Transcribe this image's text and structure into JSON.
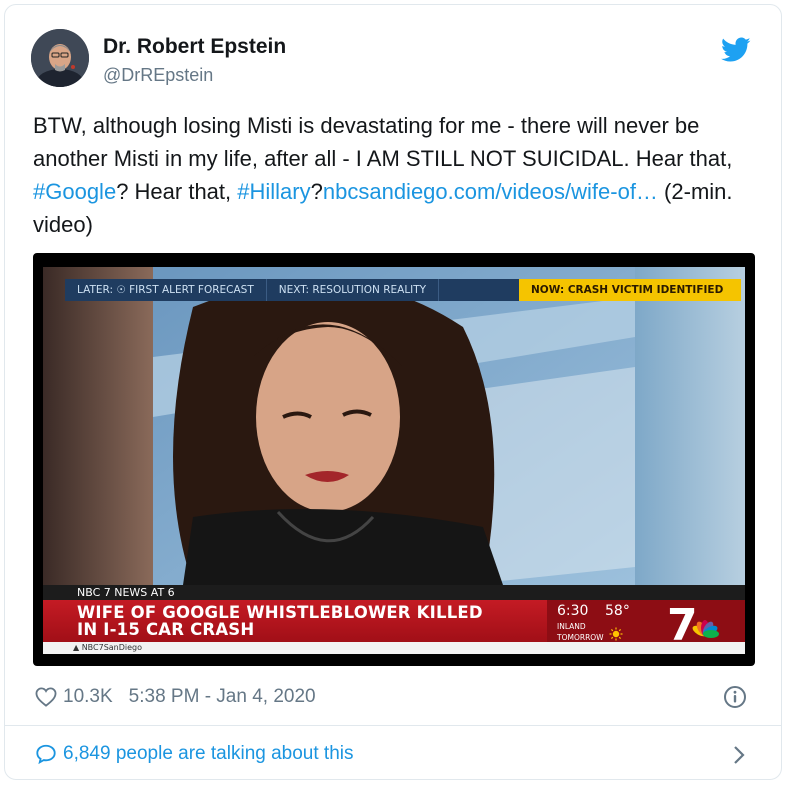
{
  "author": {
    "name": "Dr. Robert Epstein",
    "handle": "@DrREpstein"
  },
  "tweet": {
    "text_1": "BTW, although losing Misti is devastating for me - there will never be another Misti in my life, after all - I AM STILL NOT SUICIDAL. Hear that, ",
    "hashtag_google": "#Google",
    "text_2": "? Hear that, ",
    "hashtag_hillary": "#Hillary",
    "text_3": "?",
    "link": "nbcsandiego.com/videos/wife-of…",
    "text_4": " (2-min. video)"
  },
  "video": {
    "ticker_later": "LATER: ☉ FIRST ALERT FORECAST",
    "ticker_next": "NEXT: RESOLUTION REALITY",
    "ticker_now": "NOW: CRASH VICTIM IDENTIFIED",
    "station_strip": "NBC 7 NEWS AT 6",
    "headline_line1": "WIFE OF GOOGLE WHISTLEBLOWER KILLED",
    "headline_line2": "IN I-15 CAR CRASH",
    "weather_time": "6:30",
    "weather_temp": "58°",
    "weather_location": "INLAND",
    "weather_when": "TOMORROW",
    "sub_strip": "▲ NBC7SanDiego",
    "logo_text": "7"
  },
  "meta": {
    "likes": "10.3K",
    "timestamp": "5:38 PM - Jan 4, 2020"
  },
  "footer": {
    "talking": "6,849 people are talking about this"
  },
  "colors": {
    "link": "#1b95e0",
    "twitter_blue": "#1da1f2",
    "secondary_text": "#657786",
    "news_red": "#c41b24"
  },
  "icons": [
    "twitter-bird-icon",
    "heart-icon",
    "info-icon",
    "speech-bubble-icon",
    "chevron-right-icon",
    "sun-icon"
  ]
}
